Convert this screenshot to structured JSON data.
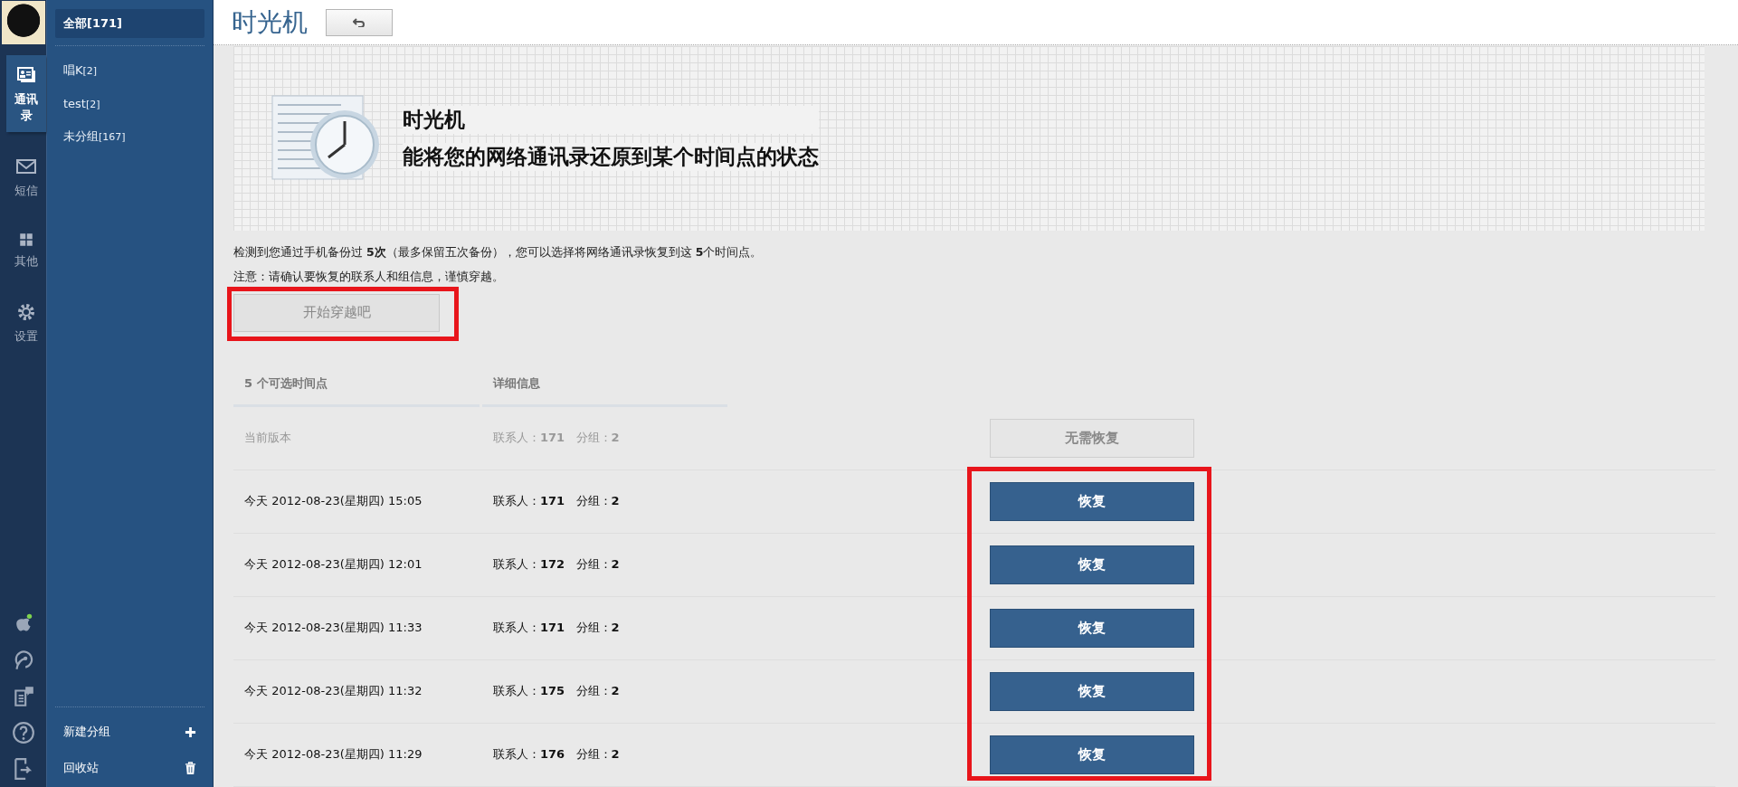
{
  "nav_rail": {
    "items": [
      {
        "label": "通讯录",
        "selected": true
      },
      {
        "label": "短信",
        "selected": false
      },
      {
        "label": "其他",
        "selected": false
      },
      {
        "label": "设置",
        "selected": false
      }
    ]
  },
  "groups": {
    "all": {
      "label": "全部[171]",
      "selected": true
    },
    "items": [
      {
        "name": "唱K",
        "count": "[2]"
      },
      {
        "name": "test",
        "count": "[2]"
      },
      {
        "name": "未分组",
        "count": "[167]"
      }
    ],
    "footer": [
      {
        "label": "新建分组"
      },
      {
        "label": "回收站"
      }
    ]
  },
  "header": {
    "title": "时光机"
  },
  "banner": {
    "title": "时光机",
    "subtitle": "能将您的网络通讯录还原到某个时间点的状态"
  },
  "info": "检测到您通过手机备份过 **5次**（最多保留五次备份），您可以选择将网络通讯录恢复到这 **5**个时间点。",
  "notice": "注意：请确认要恢复的联系人和组信息，谨慎穿越。",
  "start_button": {
    "label": "开始穿越吧",
    "disabled": true
  },
  "table": {
    "columns": [
      "5 个可选时间点",
      "详细信息"
    ],
    "rows": [
      {
        "time": "当前版本",
        "contacts_label": "联系人：",
        "contacts": "171",
        "groups_label": "分组：",
        "groups": "2",
        "action": {
          "label": "无需恢复",
          "disabled": true
        }
      },
      {
        "time": "今天 2012-08-23(星期四) 15:05",
        "contacts_label": "联系人：",
        "contacts": "171",
        "groups_label": "分组：",
        "groups": "2",
        "action": {
          "label": "恢复",
          "disabled": false
        }
      },
      {
        "time": "今天 2012-08-23(星期四) 12:01",
        "contacts_label": "联系人：",
        "contacts": "172",
        "groups_label": "分组：",
        "groups": "2",
        "action": {
          "label": "恢复",
          "disabled": false
        }
      },
      {
        "time": "今天 2012-08-23(星期四) 11:33",
        "contacts_label": "联系人：",
        "contacts": "171",
        "groups_label": "分组：",
        "groups": "2",
        "action": {
          "label": "恢复",
          "disabled": false
        }
      },
      {
        "time": "今天 2012-08-23(星期四) 11:32",
        "contacts_label": "联系人：",
        "contacts": "175",
        "groups_label": "分组：",
        "groups": "2",
        "action": {
          "label": "恢复",
          "disabled": false
        }
      },
      {
        "time": "今天 2012-08-23(星期四) 11:29",
        "contacts_label": "联系人：",
        "contacts": "176",
        "groups_label": "分组：",
        "groups": "2",
        "action": {
          "label": "恢复",
          "disabled": false
        }
      }
    ]
  }
}
